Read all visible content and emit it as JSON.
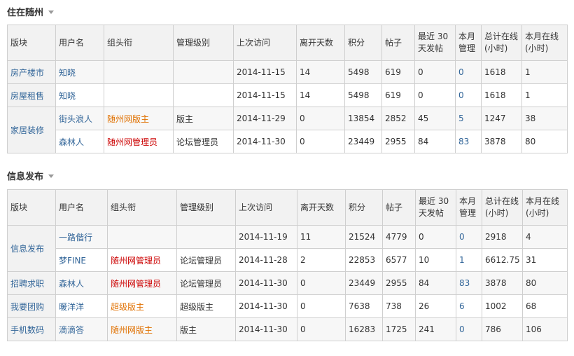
{
  "sections": [
    {
      "title": "住在随州",
      "headers": [
        "版块",
        "用户名",
        "组头衔",
        "管理级别",
        "上次访问",
        "离开天数",
        "积分",
        "帖子",
        "最近 30\n天发帖",
        "本月\n管理",
        "总计在线\n(小时)",
        "本月在线\n(小时)"
      ],
      "rows": [
        {
          "forum": "房产楼市",
          "user": "知晓",
          "title": "",
          "title_color": "",
          "level": "",
          "last": "2014-11-15",
          "days": "14",
          "points": "5498",
          "posts": "619",
          "recent": "0",
          "manage": "0",
          "total": "1618",
          "month": "1"
        },
        {
          "forum": "房屋租售",
          "user": "知晓",
          "title": "",
          "title_color": "",
          "level": "",
          "last": "2014-11-15",
          "days": "14",
          "points": "5498",
          "posts": "619",
          "recent": "0",
          "manage": "0",
          "total": "1618",
          "month": "1"
        },
        {
          "forum": "家居装修",
          "user": "街头浪人",
          "title": "随州网版主",
          "title_color": "#e07000",
          "level": "版主",
          "last": "2014-11-29",
          "days": "0",
          "points": "13854",
          "posts": "2852",
          "recent": "45",
          "manage": "5",
          "total": "1247",
          "month": "38"
        },
        {
          "forum": "",
          "user": "森林人",
          "title": "随州网管理员",
          "title_color": "#cc0000",
          "level": "论坛管理员",
          "last": "2014-11-30",
          "days": "0",
          "points": "23449",
          "posts": "2955",
          "recent": "84",
          "manage": "83",
          "total": "3878",
          "month": "80"
        }
      ]
    },
    {
      "title": "信息发布",
      "headers": [
        "版块",
        "用户名",
        "组头衔",
        "管理级别",
        "上次访问",
        "离开天数",
        "积分",
        "帖子",
        "最近 30\n天发帖",
        "本月\n管理",
        "总计在线\n(小时)",
        "本月在线\n(小时)"
      ],
      "rows": [
        {
          "forum": "信息发布",
          "user": "一路偕行",
          "title": "",
          "title_color": "",
          "level": "",
          "last": "2014-11-19",
          "days": "11",
          "points": "21524",
          "posts": "4779",
          "recent": "0",
          "manage": "0",
          "total": "2918",
          "month": "4"
        },
        {
          "forum": "",
          "user": "梦FINE",
          "title": "随州网管理员",
          "title_color": "#cc0000",
          "level": "论坛管理员",
          "last": "2014-11-28",
          "days": "2",
          "points": "22853",
          "posts": "6577",
          "recent": "10",
          "manage": "1",
          "total": "6612.75",
          "month": "31"
        },
        {
          "forum": "招聘求职",
          "user": "森林人",
          "title": "随州网管理员",
          "title_color": "#cc0000",
          "level": "论坛管理员",
          "last": "2014-11-30",
          "days": "0",
          "points": "23449",
          "posts": "2955",
          "recent": "84",
          "manage": "83",
          "total": "3878",
          "month": "80"
        },
        {
          "forum": "我要团购",
          "user": "暖洋洋",
          "title": "超级版主",
          "title_color": "#e07000",
          "level": "超级版主",
          "last": "2014-11-30",
          "days": "0",
          "points": "7638",
          "posts": "738",
          "recent": "26",
          "manage": "6",
          "total": "1002",
          "month": "68"
        },
        {
          "forum": "手机数码",
          "user": "滴滴答",
          "title": "随州网版主",
          "title_color": "#e07000",
          "level": "版主",
          "last": "2014-11-30",
          "days": "0",
          "points": "16283",
          "posts": "1725",
          "recent": "241",
          "manage": "0",
          "total": "786",
          "month": "106"
        }
      ]
    }
  ]
}
